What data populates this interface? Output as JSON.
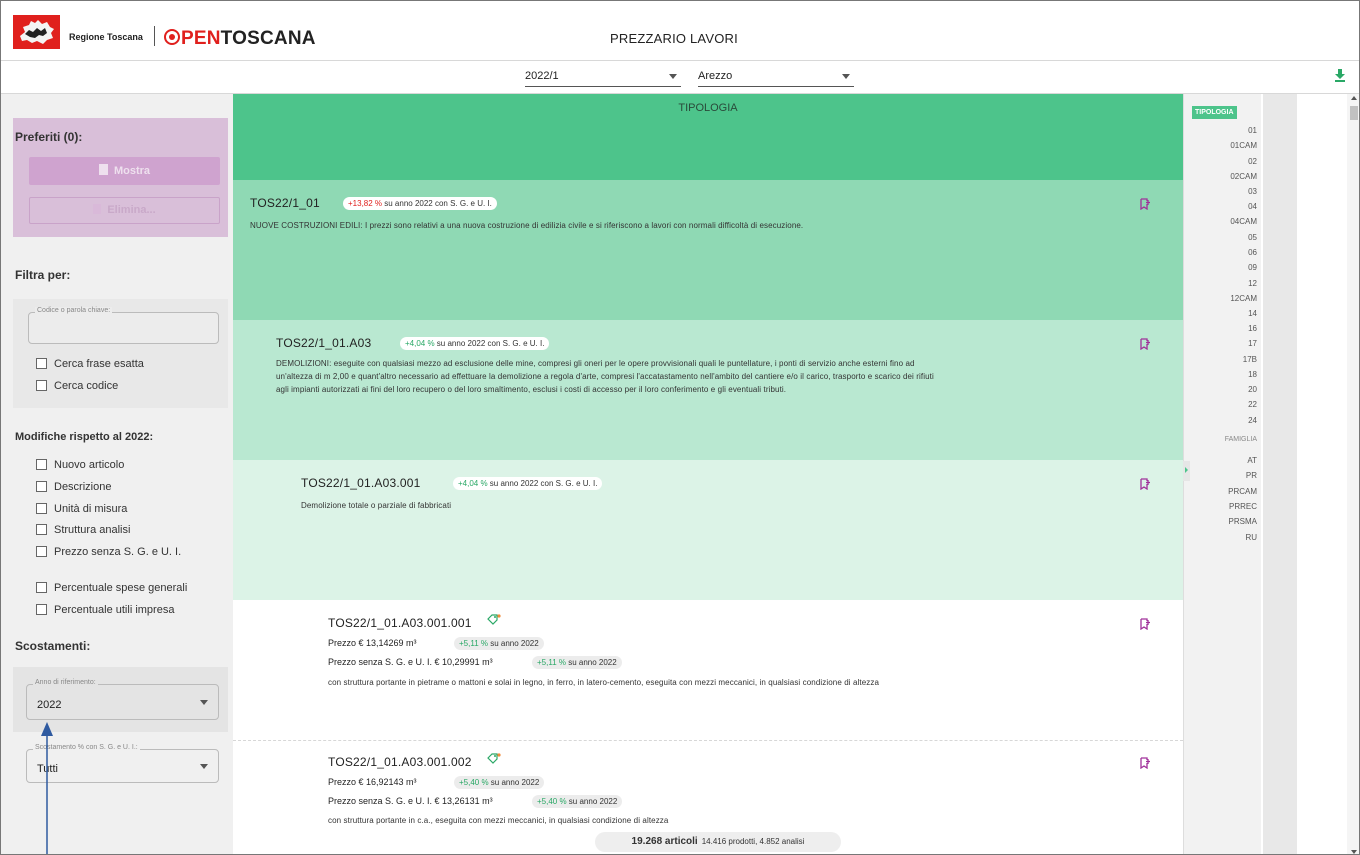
{
  "header": {
    "region_name": "Regione Toscana",
    "brand_open": "PEN",
    "brand_toscana": "TOSCANA",
    "title": "PREZZARIO LAVORI"
  },
  "toolbar": {
    "year_value": "2022/1",
    "province_value": "Arezzo"
  },
  "sidebar": {
    "favorites_title": "Preferiti (0):",
    "show_label": "Mostra",
    "delete_label": "Elimina...",
    "filter_title": "Filtra per:",
    "search_placeholder": "Codice o parola chiave:",
    "exact_phrase": "Cerca frase esatta",
    "search_code": "Cerca codice",
    "changes_title": "Modifiche rispetto al 2022:",
    "changes": [
      "Nuovo articolo",
      "Descrizione",
      "Unità di misura",
      "Struttura analisi",
      "Prezzo senza S. G. e U. I."
    ],
    "percentages": [
      "Percentuale spese generali",
      "Percentuale utili impresa"
    ],
    "deviations_title": "Scostamenti:",
    "ref_year_label": "Anno di riferimento:",
    "ref_year_value": "2022",
    "deviation_label": "Scostamento % con S. G. e U. I.:",
    "deviation_value": "Tutti"
  },
  "main": {
    "tipologia_title": "TIPOLOGIA",
    "levels": [
      {
        "code": "TOS22/1_01",
        "pct": "+13,82 %",
        "pct_suffix": " su anno 2022 con S. G. e U. I.",
        "desc": "NUOVE COSTRUZIONI EDILI: I prezzi sono relativi a una nuova costruzione di edilizia civile e si riferiscono a lavori con normali difficoltà di esecuzione."
      },
      {
        "code": "TOS22/1_01.A03",
        "pct": "+4,04 %",
        "pct_suffix": " su anno 2022 con S. G. e U. I.",
        "desc1": "DEMOLIZIONI: eseguite con qualsiasi mezzo ad esclusione delle mine, compresi gli oneri per le opere provvisionali quali le puntellature, i ponti di servizio anche esterni fino ad",
        "desc2": "un'altezza di m 2,00 e quant'altro necessario ad effettuare la demolizione a regola d'arte, compresi l'accatastamento nell'ambito del cantiere e/o il carico, trasporto e scarico dei rifiuti",
        "desc3": "agli impianti autorizzati ai fini del loro recupero o del loro smaltimento, esclusi i costi di accesso per il loro conferimento e gli eventuali tributi."
      },
      {
        "code": "TOS22/1_01.A03.001",
        "pct": "+4,04 %",
        "pct_suffix": " su anno 2022 con S. G. e U. I.",
        "desc": "Demolizione totale o parziale di fabbricati"
      }
    ],
    "articles": [
      {
        "code": "TOS22/1_01.A03.001.001",
        "price": "Prezzo € 13,14269 m³",
        "price_pct": "+5,11 %",
        "price_suffix": " su anno 2022",
        "price_nosg": "Prezzo senza S. G. e U. I. € 10,29991 m³",
        "nosg_pct": "+5,11 %",
        "nosg_suffix": " su anno 2022",
        "desc": "con struttura portante in pietrame o mattoni e solai in legno, in ferro, in latero-cemento, eseguita con mezzi meccanici, in qualsiasi condizione di altezza"
      },
      {
        "code": "TOS22/1_01.A03.001.002",
        "price": "Prezzo € 16,92143 m³",
        "price_pct": "+5,40 %",
        "price_suffix": " su anno 2022",
        "price_nosg": "Prezzo senza S. G. e U. I. € 13,26131 m³",
        "nosg_pct": "+5,40 %",
        "nosg_suffix": " su anno 2022",
        "desc": "con struttura portante in c.a., eseguita con mezzi meccanici, in qualsiasi condizione di altezza"
      }
    ],
    "counter_main": "19.268 articoli",
    "counter_sub": "14.416 prodotti, 4.852 analisi"
  },
  "index": {
    "tipologia_tag": "TIPOLOGIA",
    "tipologia_items": [
      "01",
      "01CAM",
      "02",
      "02CAM",
      "03",
      "04",
      "04CAM",
      "05",
      "06",
      "09",
      "12",
      "12CAM",
      "14",
      "16",
      "17",
      "17B",
      "18",
      "20",
      "22",
      "24"
    ],
    "famiglia_head": "FAMIGLIA",
    "famiglia_items": [
      "AT",
      "PR",
      "PRCAM",
      "PRREC",
      "PRSMA",
      "RU"
    ]
  },
  "colors": {
    "accent_green": "#4dc48b",
    "brand_red": "#e0201d",
    "favorites_purple": "#d9bfd9",
    "bookmark_purple": "#a0309a"
  }
}
